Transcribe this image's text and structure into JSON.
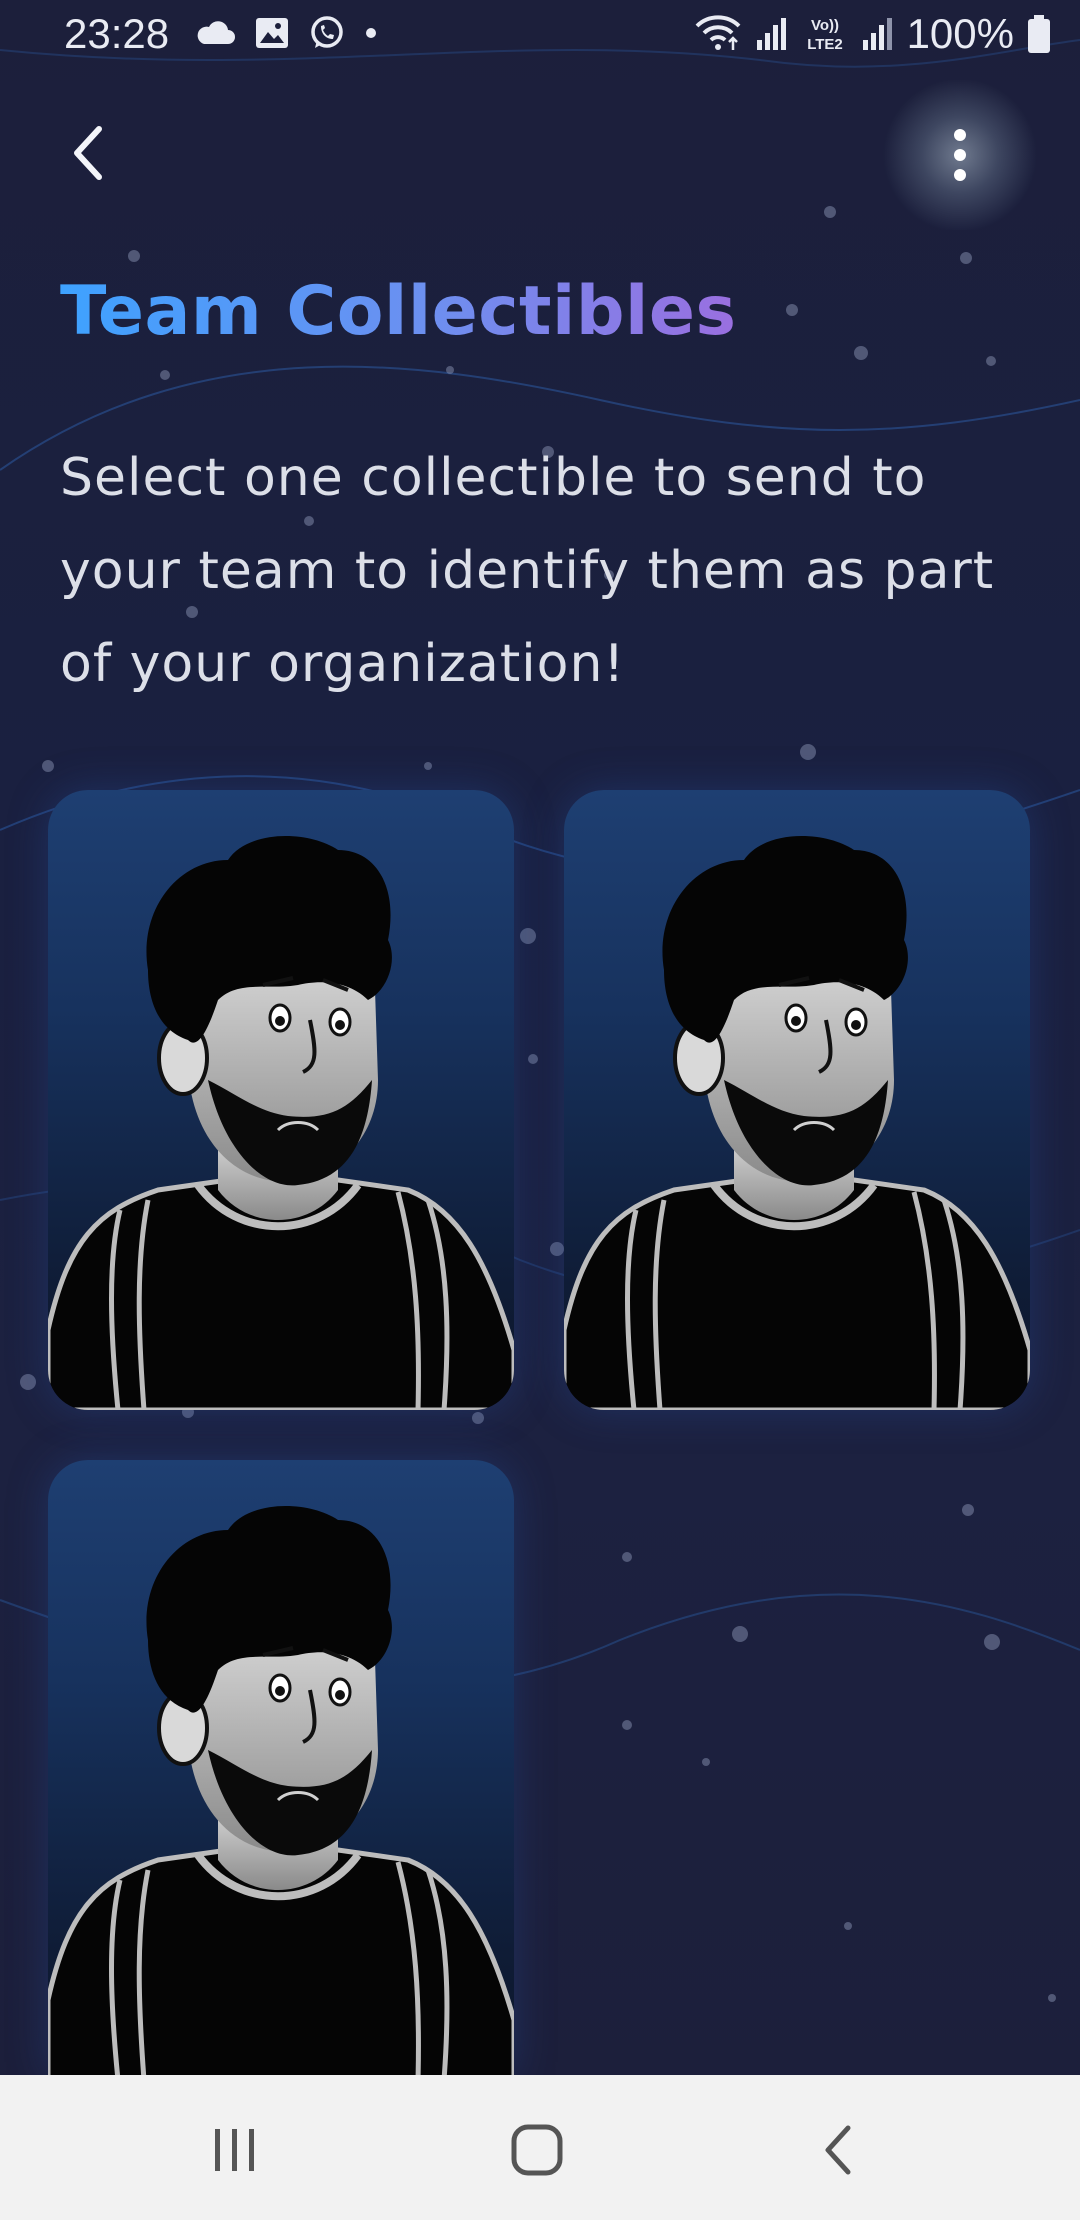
{
  "status_bar": {
    "time": "23:28",
    "battery": "100%",
    "left_icons": [
      "cloud-icon",
      "image-icon",
      "whatsapp-icon",
      "dot-icon"
    ],
    "right_icons": [
      "wifi-icon",
      "signal-icon",
      "volte-icon",
      "signal-icon",
      "battery-icon"
    ]
  },
  "app_bar": {
    "back_icon": "chevron-left-icon",
    "more_icon": "more-vert-icon"
  },
  "page": {
    "title": "Team Collectibles",
    "description": "Select one collectible to send to your team to identify them as part of your organization!"
  },
  "collectibles": [
    {
      "id": "card-1",
      "image": "bearded-man-avatar"
    },
    {
      "id": "card-2",
      "image": "bearded-man-avatar"
    },
    {
      "id": "card-3",
      "image": "bearded-man-avatar"
    }
  ],
  "nav_bar": {
    "icons": [
      "recents-icon",
      "home-icon",
      "back-icon"
    ]
  },
  "colors": {
    "background": "#1c1f3b",
    "title_gradient_start": "#3ea2ff",
    "title_gradient_end": "#9a6fe0",
    "card_top": "#1e3f72",
    "nav_background": "#f2f2f2"
  }
}
